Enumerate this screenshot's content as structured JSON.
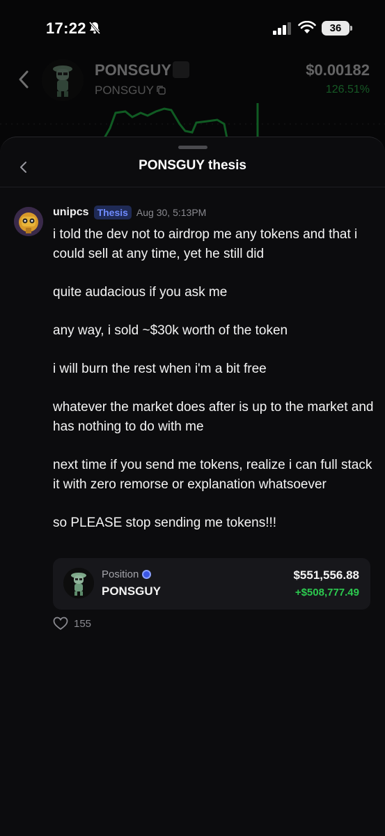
{
  "status_bar": {
    "time": "17:22",
    "battery": "36"
  },
  "token_header": {
    "name": "PONSGUY",
    "ticker": "PONSGUY",
    "price": "$0.00182",
    "change": "126.51%",
    "change_color": "#2cc94f"
  },
  "sheet": {
    "title": "PONSGUY thesis"
  },
  "post": {
    "author": "unipcs",
    "badge": "Thesis",
    "date": "Aug 30, 5:13PM",
    "paragraphs": [
      "i told the dev not to airdrop me any tokens and that i could sell at any time, yet he still did",
      "quite audacious if you ask me",
      "any way, i sold ~$30k worth of the token",
      "i will burn the rest when i'm a bit free",
      "whatever the market does after is up to the market and has nothing to do with me",
      "next time if you send me tokens, realize i can full stack it with zero remorse or explanation whatsoever",
      "so PLEASE stop sending me tokens!!!"
    ],
    "position": {
      "label": "Position",
      "token": "PONSGUY",
      "value": "$551,556.88",
      "pnl": "+$508,777.49"
    },
    "likes": "155"
  },
  "icons": {
    "muted": "bell-off-icon",
    "signal": "cellular-signal-icon",
    "wifi": "wifi-icon",
    "back": "chevron-left-icon",
    "copy": "copy-icon",
    "verified": "verified-badge-icon",
    "like": "heart-icon"
  }
}
